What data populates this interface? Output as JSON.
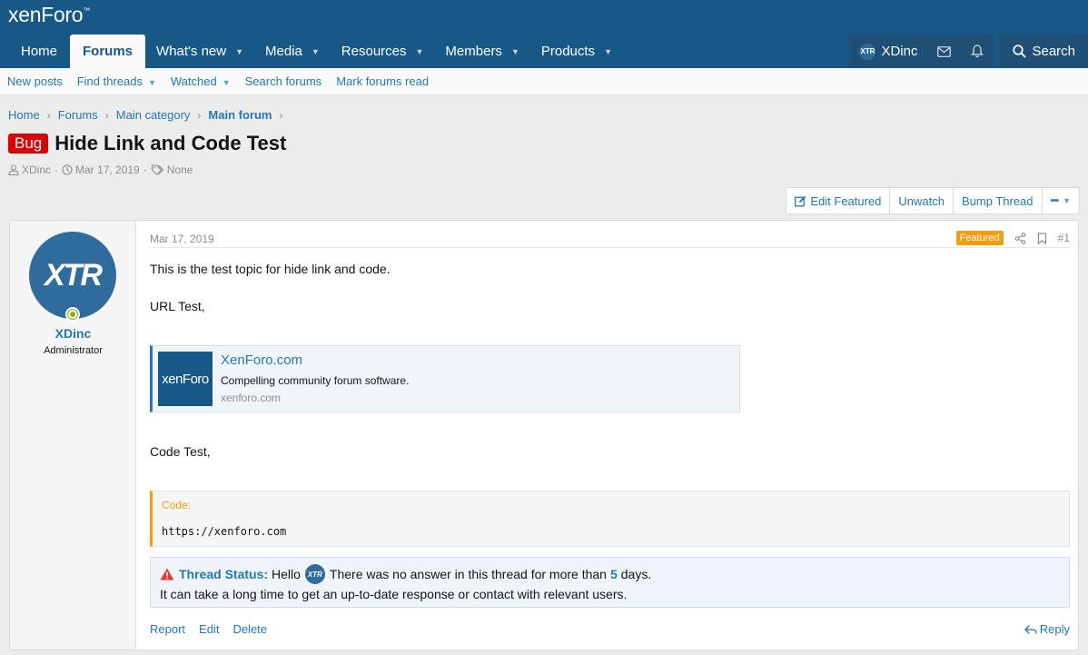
{
  "brand": {
    "logo_main": "xenForo",
    "logo_mark": "™"
  },
  "nav": {
    "tabs": [
      {
        "label": "Home",
        "has_caret": false
      },
      {
        "label": "Forums",
        "has_caret": false,
        "active": true
      },
      {
        "label": "What's new",
        "has_caret": true
      },
      {
        "label": "Media",
        "has_caret": true
      },
      {
        "label": "Resources",
        "has_caret": true
      },
      {
        "label": "Members",
        "has_caret": true
      },
      {
        "label": "Products",
        "has_caret": true
      }
    ],
    "user_label": "XDinc",
    "user_avatar_text": "XTR",
    "search_label": "Search"
  },
  "subnav": {
    "items": [
      {
        "label": "New posts"
      },
      {
        "label": "Find threads",
        "has_caret": true
      },
      {
        "label": "Watched",
        "has_caret": true
      },
      {
        "label": "Search forums"
      },
      {
        "label": "Mark forums read"
      }
    ]
  },
  "breadcrumb": [
    "Home",
    "Forums",
    "Main category",
    "Main forum"
  ],
  "thread": {
    "prefix": "Bug",
    "title": "Hide Link and Code Test",
    "author": "XDinc",
    "date": "Mar 17, 2019",
    "tags": "None",
    "buttons": {
      "edit_featured": "Edit Featured",
      "unwatch": "Unwatch",
      "bump": "Bump Thread",
      "more": "•••"
    }
  },
  "post": {
    "username": "XDinc",
    "user_title": "Administrator",
    "avatar_text": "XTR",
    "date": "Mar 17, 2019",
    "featured_badge": "Featured",
    "number": "#1",
    "line1": "This is the test topic for hide link and code.",
    "line2": "URL Test,",
    "unfurl": {
      "title": "XenForo.com",
      "description": "Compelling community forum software.",
      "domain": "xenforo.com",
      "logo": "xenForo"
    },
    "line3": "Code Test,",
    "code": {
      "label": "Code:",
      "content": "https://xenforo.com"
    },
    "status": {
      "title": "Thread Status:",
      "hello": "Hello",
      "message": "There was no answer in this thread for more than",
      "days_value": "5",
      "days_suffix": "days.",
      "line2": "It can take a long time to get an up-to-date response or contact with relevant users."
    },
    "actions": {
      "report": "Report",
      "edit": "Edit",
      "delete": "Delete",
      "reply": "Reply"
    }
  },
  "colors": {
    "header": "#185886",
    "link": "#2577b1",
    "bug_label": "#dc0000",
    "featured": "#f39c12"
  }
}
